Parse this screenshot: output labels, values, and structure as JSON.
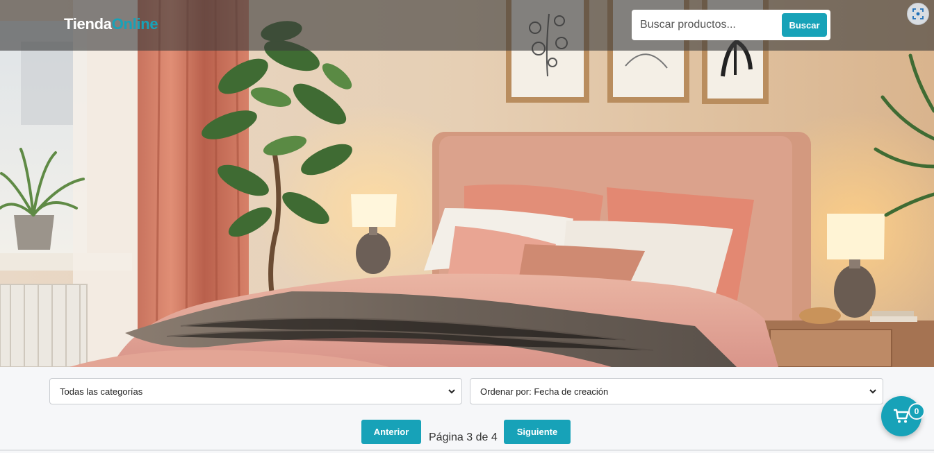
{
  "header": {
    "brand_part1": "Tienda",
    "brand_part2": "Online",
    "search_placeholder": "Buscar productos...",
    "search_button": "Buscar",
    "capture_icon": "screen-capture-icon"
  },
  "hero": {
    "image": "bedroom-scene"
  },
  "filters": {
    "category_selected": "Todas las categorías",
    "sort_selected": "Ordenar por: Fecha de creación"
  },
  "pagination": {
    "prev_label": "Anterior",
    "page_info": "Página 3 de 4",
    "next_label": "Siguiente"
  },
  "cart": {
    "icon": "cart-icon",
    "count": "0"
  },
  "colors": {
    "accent": "#17a2b8",
    "header_overlay": "rgba(60,60,60,0.62)",
    "background": "#f6f7f9"
  }
}
